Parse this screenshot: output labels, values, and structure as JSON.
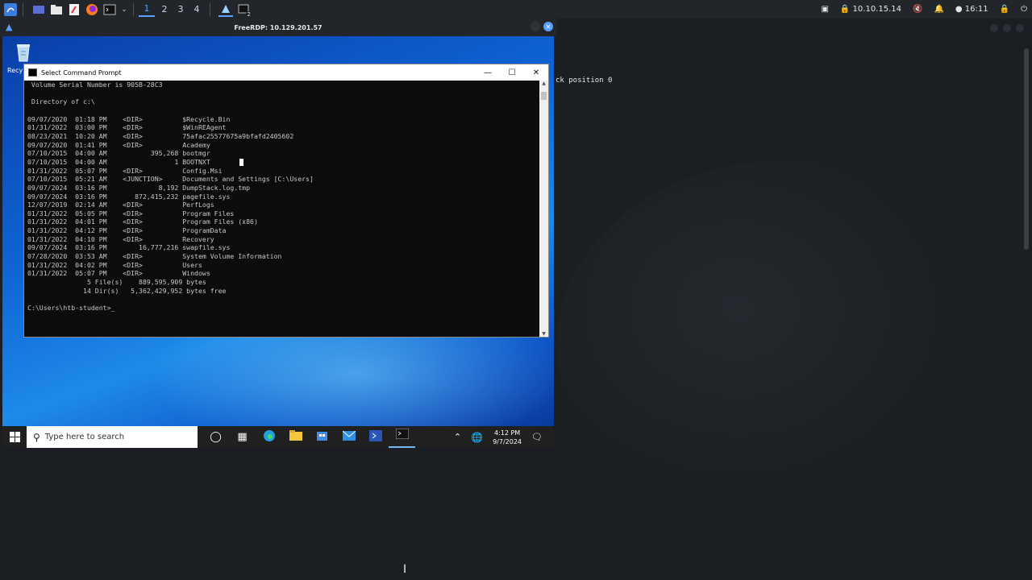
{
  "top_panel": {
    "workspaces": [
      "1",
      "2",
      "3",
      "4"
    ],
    "terminal_badge": "2",
    "ip": "10.10.15.14",
    "time": "16:11"
  },
  "rdp": {
    "title": "FreeRDP: 10.129.201.57",
    "recycle_label": "Recy"
  },
  "side": {
    "text": "ck position 0"
  },
  "cmd": {
    "title": "Select Command Prompt",
    "lines": [
      " Volume Serial Number is 905B-28C3",
      "",
      " Directory of c:\\",
      "",
      "09/07/2020  01:18 PM    <DIR>          $Recycle.Bin",
      "01/31/2022  03:00 PM    <DIR>          $WinREAgent",
      "08/23/2021  10:20 AM    <DIR>          75afac25577675a9bfafd2405602",
      "09/07/2020  01:41 PM    <DIR>          Academy",
      "07/10/2015  04:00 AM           395,268 bootmgr",
      "07/10/2015  04:00 AM                 1 BOOTNXT",
      "01/31/2022  05:07 PM    <DIR>          Config.Msi",
      "07/10/2015  05:21 AM    <JUNCTION>     Documents and Settings [C:\\Users]",
      "09/07/2024  03:16 PM             8,192 DumpStack.log.tmp",
      "09/07/2024  03:16 PM       872,415,232 pagefile.sys",
      "12/07/2019  02:14 AM    <DIR>          PerfLogs",
      "01/31/2022  05:05 PM    <DIR>          Program Files",
      "01/31/2022  04:01 PM    <DIR>          Program Files (x86)",
      "01/31/2022  04:12 PM    <DIR>          ProgramData",
      "01/31/2022  04:10 PM    <DIR>          Recovery",
      "09/07/2024  03:16 PM        16,777,216 swapfile.sys",
      "07/28/2020  03:53 AM    <DIR>          System Volume Information",
      "01/31/2022  04:02 PM    <DIR>          Users",
      "01/31/2022  05:07 PM    <DIR>          Windows",
      "               5 File(s)    889,595,909 bytes",
      "              14 Dir(s)   5,362,429,952 bytes free",
      ""
    ],
    "prompt": "C:\\Users\\htb-student>"
  },
  "taskbar": {
    "search_placeholder": "Type here to search",
    "time": "4:12 PM",
    "date": "9/7/2024"
  }
}
